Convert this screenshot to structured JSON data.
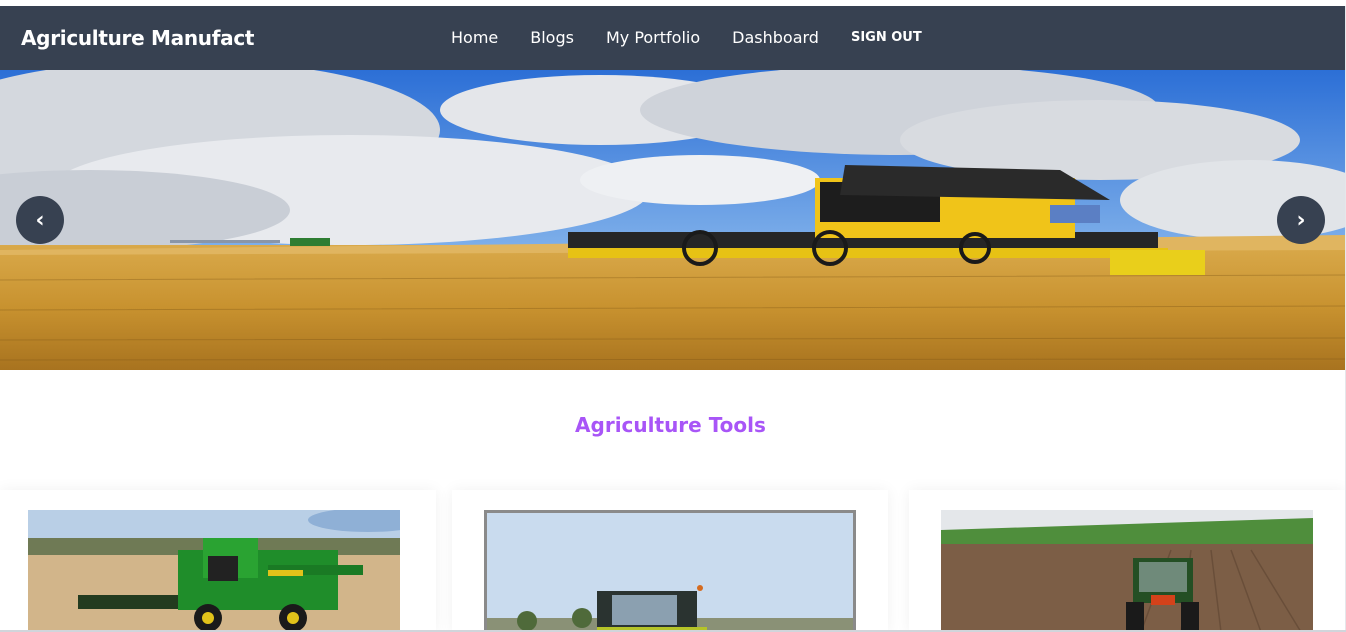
{
  "navbar": {
    "brand": "Agriculture Manufact",
    "links": [
      {
        "label": "Home"
      },
      {
        "label": "Blogs"
      },
      {
        "label": "My Portfolio"
      },
      {
        "label": "Dashboard"
      },
      {
        "label": "SIGN OUT"
      }
    ]
  },
  "carousel": {
    "prev_label": "‹",
    "next_label": "›",
    "icons": {
      "prev": "chevron-left-icon",
      "next": "chevron-right-icon"
    }
  },
  "section": {
    "title": "Agriculture Tools"
  },
  "colors": {
    "navbar_bg": "#374151",
    "title_purple": "#a855f7",
    "carousel_button": "#374151"
  }
}
